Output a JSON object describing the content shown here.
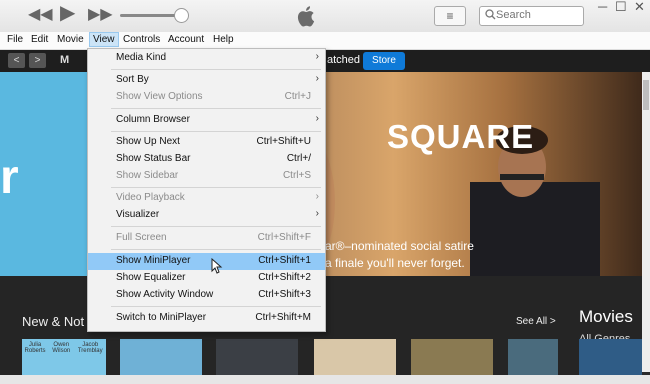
{
  "toolbar": {
    "search_placeholder": "Search",
    "list_icon": "≡",
    "win_minimize": "─",
    "win_maximize": "☐",
    "win_close": "✕"
  },
  "menubar": {
    "items": [
      "File",
      "Edit",
      "Movie",
      "View",
      "Controls",
      "Account",
      "Help"
    ]
  },
  "nav": {
    "back": "<",
    "forward": ">",
    "tab_partial_left": "M",
    "tab_partial": "atched",
    "store": "Store"
  },
  "banner": {
    "left_fragment": "r",
    "title": "SQUARE",
    "line1": "ar®–nominated social satire",
    "line2": "a finale you'll never forget."
  },
  "content": {
    "heading": "New & Not",
    "see_all": "See All >",
    "movies_title": "Movies",
    "genres": "All Genres ⌄",
    "poster_names": [
      "Julia Roberts",
      "Owen Wilson",
      "Jacob Tremblay"
    ]
  },
  "view_menu": {
    "items": [
      {
        "label": "Media Kind",
        "shortcut": "",
        "submenu": true,
        "disabled": false
      },
      {
        "label": "Sort By",
        "shortcut": "",
        "submenu": true,
        "disabled": false
      },
      {
        "label": "Show View Options",
        "shortcut": "Ctrl+J",
        "submenu": false,
        "disabled": true
      },
      {
        "label": "Column Browser",
        "shortcut": "",
        "submenu": true,
        "disabled": false
      },
      {
        "label": "Show Up Next",
        "shortcut": "Ctrl+Shift+U",
        "submenu": false,
        "disabled": false
      },
      {
        "label": "Show Status Bar",
        "shortcut": "Ctrl+/",
        "submenu": false,
        "disabled": false
      },
      {
        "label": "Show Sidebar",
        "shortcut": "Ctrl+S",
        "submenu": false,
        "disabled": true
      },
      {
        "label": "Video Playback",
        "shortcut": "",
        "submenu": true,
        "disabled": true
      },
      {
        "label": "Visualizer",
        "shortcut": "",
        "submenu": true,
        "disabled": false
      },
      {
        "label": "Full Screen",
        "shortcut": "Ctrl+Shift+F",
        "submenu": false,
        "disabled": true
      },
      {
        "label": "Show MiniPlayer",
        "shortcut": "Ctrl+Shift+1",
        "submenu": false,
        "disabled": false,
        "highlighted": true
      },
      {
        "label": "Show Equalizer",
        "shortcut": "Ctrl+Shift+2",
        "submenu": false,
        "disabled": false
      },
      {
        "label": "Show Activity Window",
        "shortcut": "Ctrl+Shift+3",
        "submenu": false,
        "disabled": false
      },
      {
        "label": "Switch to MiniPlayer",
        "shortcut": "Ctrl+Shift+M",
        "submenu": false,
        "disabled": false
      }
    ]
  },
  "colors": {
    "store_blue": "#0f7ad8",
    "highlight": "#91c9f7",
    "banner_left": "#5ab8e0"
  }
}
